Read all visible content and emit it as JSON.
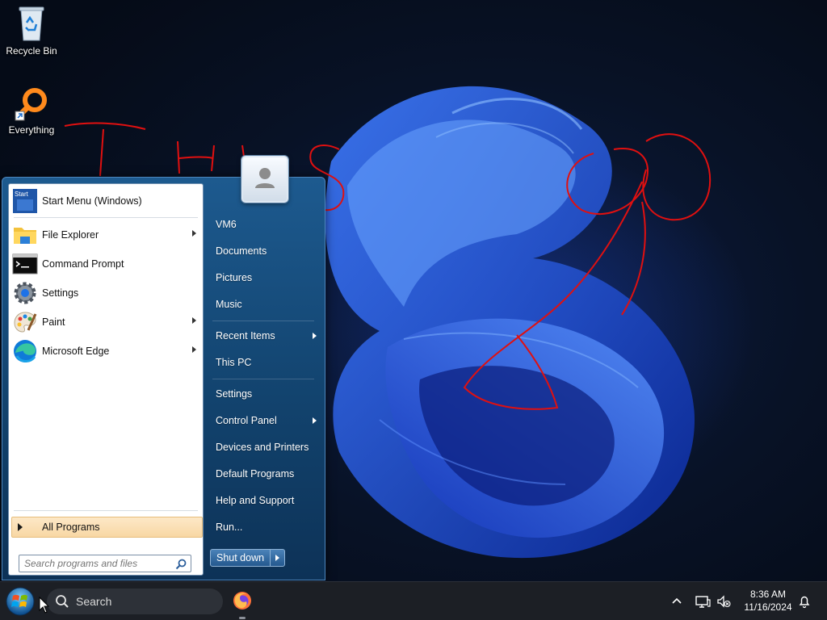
{
  "desktop": {
    "icons": [
      {
        "label": "Recycle Bin",
        "icon": "recycle-bin-icon"
      },
      {
        "label": "Everything",
        "icon": "everything-search-icon"
      }
    ],
    "handwriting": "This ?"
  },
  "start_menu": {
    "pinned": [
      {
        "label": "Start Menu (Windows)",
        "icon": "start-menu-app-icon",
        "submenu": false
      },
      {
        "label": "File Explorer",
        "icon": "folder-icon",
        "submenu": true
      },
      {
        "label": "Command Prompt",
        "icon": "command-prompt-icon",
        "submenu": false
      },
      {
        "label": "Settings",
        "icon": "gear-icon",
        "submenu": false
      },
      {
        "label": "Paint",
        "icon": "paint-palette-icon",
        "submenu": true
      },
      {
        "label": "Microsoft Edge",
        "icon": "edge-icon",
        "submenu": true
      }
    ],
    "start_icon_text": "Start",
    "all_programs": "All Programs",
    "search_placeholder": "Search programs and files",
    "right_items": [
      {
        "label": "VM6",
        "submenu": false
      },
      {
        "label": "Documents",
        "submenu": false
      },
      {
        "label": "Pictures",
        "submenu": false
      },
      {
        "label": "Music",
        "submenu": false
      },
      {
        "label": "Recent Items",
        "submenu": true
      },
      {
        "label": "This PC",
        "submenu": false
      },
      {
        "label": "Settings",
        "submenu": false
      },
      {
        "label": "Control Panel",
        "submenu": true
      },
      {
        "label": "Devices and Printers",
        "submenu": false
      },
      {
        "label": "Default Programs",
        "submenu": false
      },
      {
        "label": "Help and Support",
        "submenu": false
      },
      {
        "label": "Run...",
        "submenu": false
      }
    ],
    "shutdown": "Shut down"
  },
  "taskbar": {
    "search_label": "Search",
    "apps": [
      {
        "name": "Firefox",
        "icon": "firefox-icon"
      }
    ],
    "tray": {
      "time": "8:36 AM",
      "date": "11/16/2024",
      "icons": [
        "chevron-up-icon",
        "network-icon",
        "volume-muted-icon",
        "notification-bell-icon"
      ]
    }
  },
  "colors": {
    "start_menu_blue": "#1d5a8f",
    "all_programs_highlight": "#f8d7a4",
    "taskbar": "#1c1f25",
    "wallpaper_bloom": "#1a4de0",
    "annotation_red": "#e01010"
  }
}
